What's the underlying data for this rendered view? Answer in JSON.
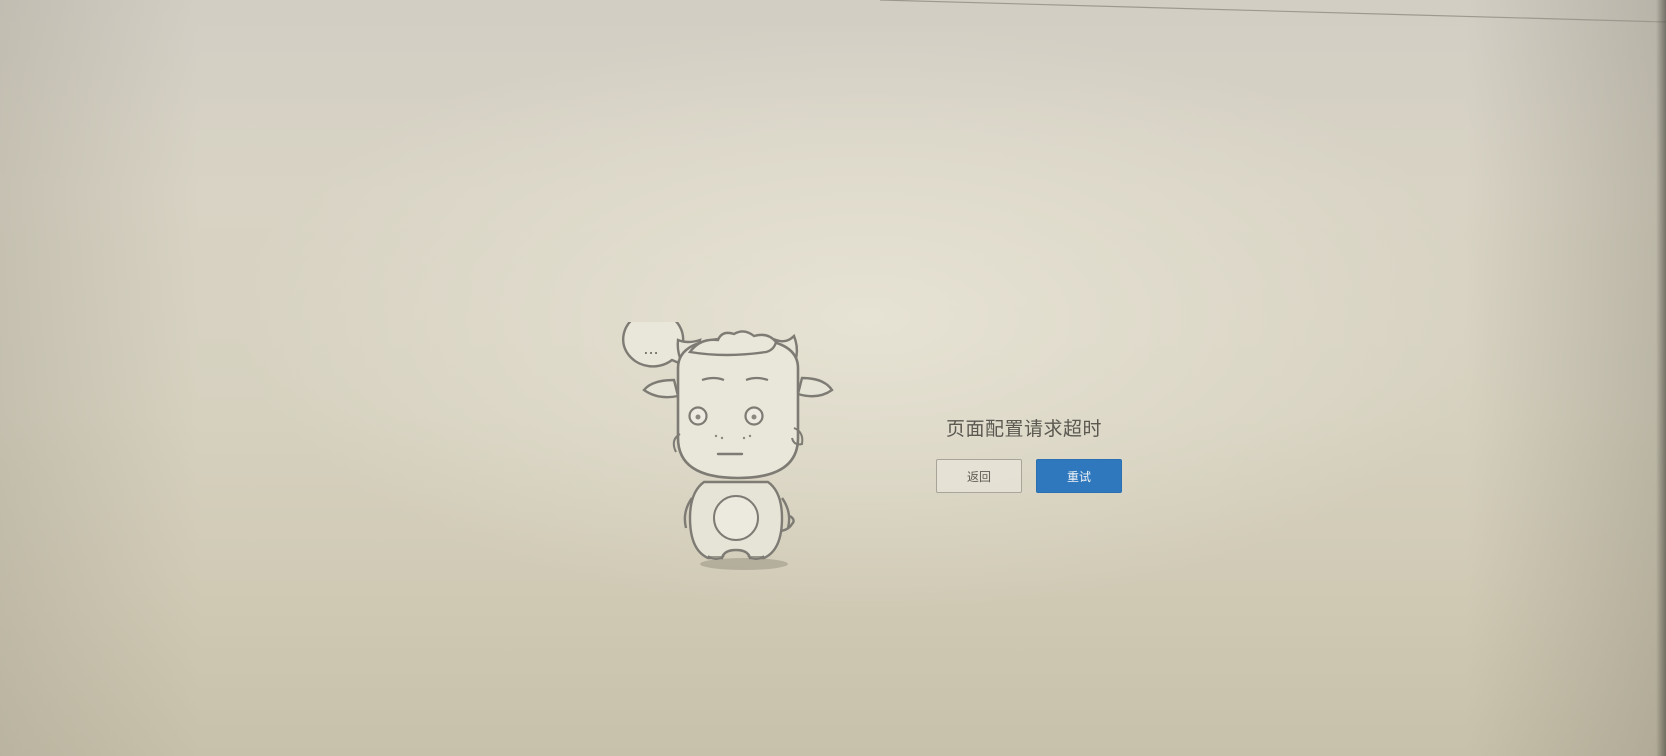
{
  "error": {
    "message": "页面配置请求超时"
  },
  "actions": {
    "back_label": "返回",
    "retry_label": "重试"
  },
  "mascot": {
    "bubble_text": "...",
    "icon": "goat-mascot-icon"
  },
  "colors": {
    "primary": "#2f78bd",
    "text": "#5a5850",
    "outline": "#8a887e"
  }
}
